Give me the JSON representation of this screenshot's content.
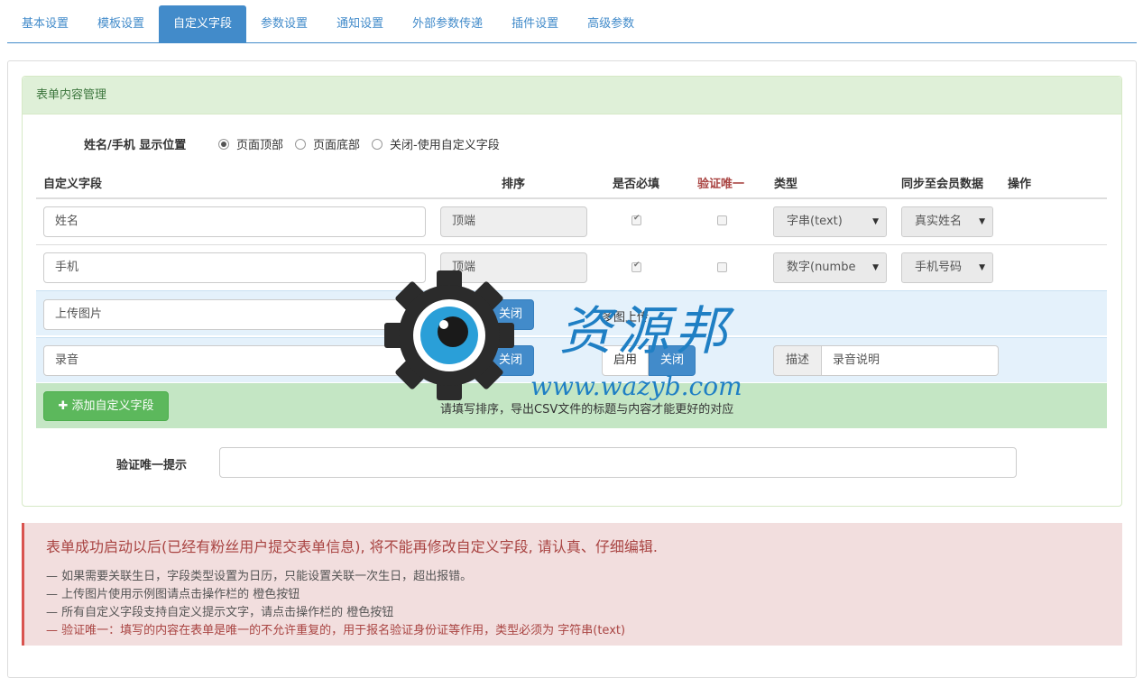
{
  "tabs": [
    {
      "label": "基本设置"
    },
    {
      "label": "模板设置"
    },
    {
      "label": "自定义字段"
    },
    {
      "label": "参数设置"
    },
    {
      "label": "通知设置"
    },
    {
      "label": "外部参数传递"
    },
    {
      "label": "插件设置"
    },
    {
      "label": "高级参数"
    }
  ],
  "active_tab": 2,
  "panel": {
    "title": "表单内容管理",
    "position_label": "姓名/手机 显示位置",
    "position_options": [
      "页面顶部",
      "页面底部",
      "关闭-使用自定义字段"
    ],
    "position_selected": "页面顶部"
  },
  "table": {
    "headers": {
      "field": "自定义字段",
      "order": "排序",
      "required": "是否必填",
      "unique": "验证唯一",
      "type": "类型",
      "sync": "同步至会员数据",
      "action": "操作"
    },
    "rows": [
      {
        "name": "姓名",
        "order": "顶端",
        "required": true,
        "unique": false,
        "type": "字串(text)",
        "sync": "真实姓名"
      },
      {
        "name": "手机",
        "order": "顶端",
        "required": true,
        "unique": false,
        "type": "数字(numbe",
        "sync": "手机号码"
      }
    ],
    "extra_rows": [
      {
        "name": "上传图片",
        "enable": "启用",
        "close": "关闭",
        "note": "多图上传"
      },
      {
        "name": "录音",
        "enable": "启用",
        "close": "关闭",
        "enable2": "启用",
        "close2": "关闭",
        "desc_label": "描述",
        "desc_value": "录音说明"
      }
    ]
  },
  "add_button": "添加自定义字段",
  "hint": "请填写排序，导出CSV文件的标题与内容才能更好的对应",
  "unique_tip_label": "验证唯一提示",
  "unique_tip_value": "",
  "alert": {
    "title": "表单成功启动以后(已经有粉丝用户提交表单信息), 将不能再修改自定义字段, 请认真、仔细编辑.",
    "lines": [
      "— 如果需要关联生日，字段类型设置为日历，只能设置关联一次生日，超出报错。",
      "— 上传图片使用示例图请点击操作栏的 橙色按钮",
      "— 所有自定义字段支持自定义提示文字，请点击操作栏的 橙色按钮",
      "— 验证唯一：填写的内容在表单是唯一的不允许重复的，用于报名验证身份证等作用，类型必须为 字符串(text)"
    ]
  },
  "watermark": {
    "cn": "资源邦",
    "url": "www.wazyb.com"
  },
  "colors": {
    "primary": "#428bca",
    "success": "#5cb85c",
    "danger_text": "#a94442",
    "panel_head": "#dff0d8"
  }
}
